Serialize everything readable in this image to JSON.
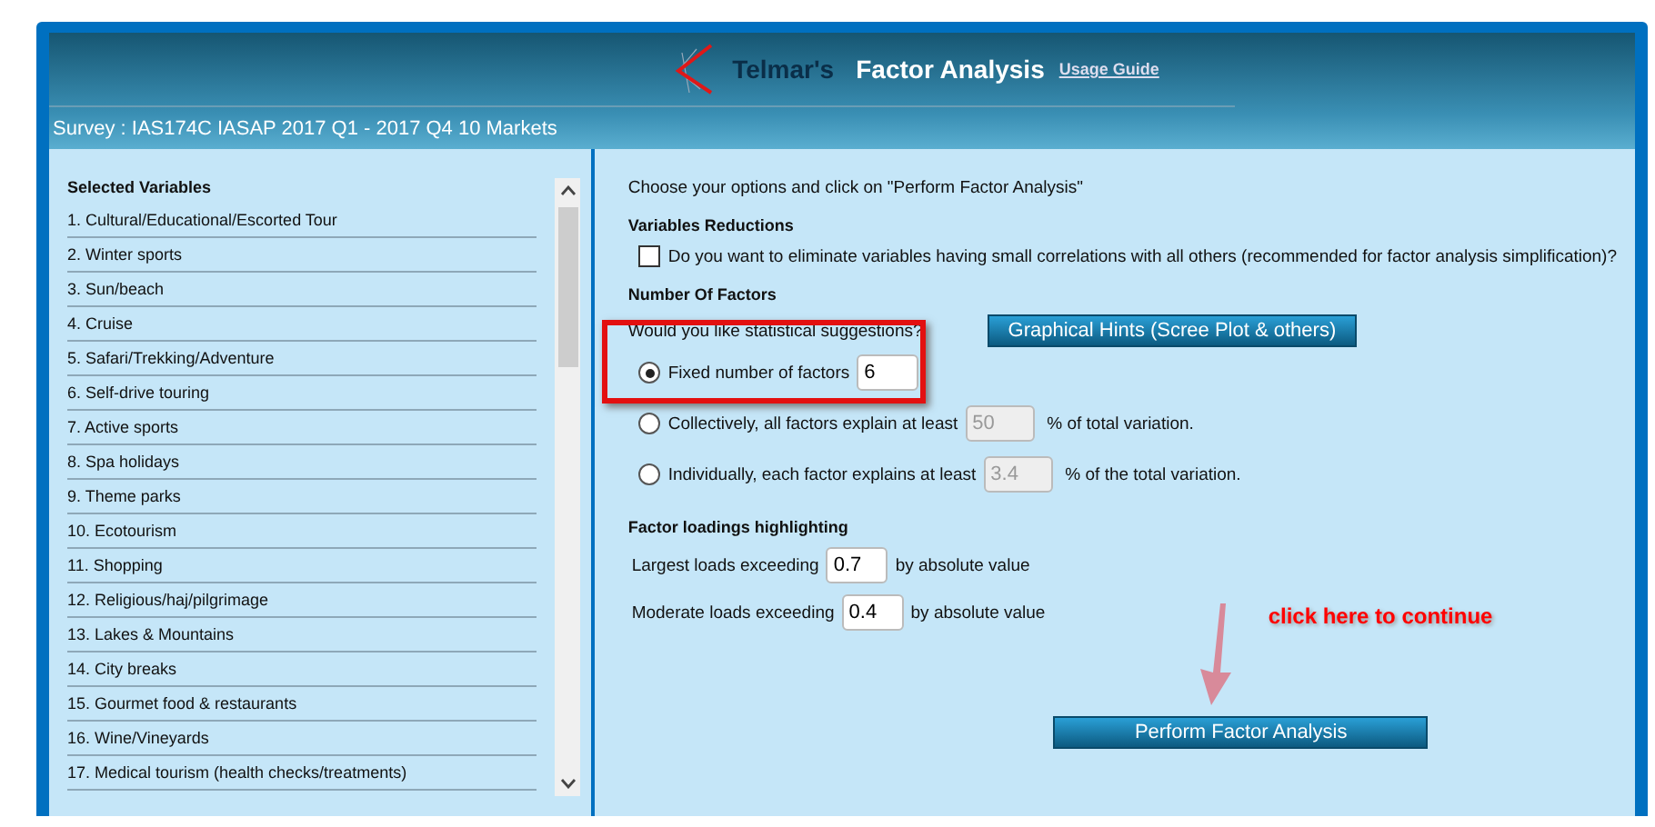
{
  "header": {
    "brand": "Telmar's",
    "title": "Factor Analysis",
    "link": "Usage Guide"
  },
  "survey": "Survey : IAS174C IASAP 2017 Q1 - 2017 Q4 10 Markets",
  "variables": {
    "heading": "Selected Variables",
    "items": [
      "1. Cultural/Educational/Escorted Tour",
      "2. Winter sports",
      "3. Sun/beach",
      "4. Cruise",
      "5. Safari/Trekking/Adventure",
      "6. Self-drive touring",
      "7. Active sports",
      "8. Spa holidays",
      "9. Theme parks",
      "10. Ecotourism",
      "11. Shopping",
      "12. Religious/haj/pilgrimage",
      "13. Lakes & Mountains",
      "14. City breaks",
      "15. Gourmet food & restaurants",
      "16. Wine/Vineyards",
      "17. Medical tourism (health checks/treatments)"
    ]
  },
  "options": {
    "intro": "Choose your options and click on \"Perform Factor Analysis\"",
    "reductions": {
      "heading": "Variables Reductions",
      "label": "Do you want to eliminate variables having small correlations with all others (recommended for factor analysis simplification)?",
      "checked": false
    },
    "factors": {
      "heading": "Number Of Factors",
      "question": "Would you like statistical suggestions?",
      "hints_button": "Graphical Hints (Scree Plot & others)",
      "choices": [
        {
          "label": "Fixed number of factors",
          "value": "6",
          "selected": true,
          "disabled": false
        },
        {
          "label": "Collectively, all factors explain at least",
          "value": "50",
          "suffix": "% of total variation.",
          "selected": false,
          "disabled": true
        },
        {
          "label": "Individually, each factor explains at least",
          "value": "3.4",
          "suffix": "% of the total variation.",
          "selected": false,
          "disabled": true
        }
      ]
    },
    "loadings": {
      "heading": "Factor loadings highlighting",
      "rows": [
        {
          "label": "Largest loads exceeding",
          "value": "0.7",
          "suffix": "by absolute value"
        },
        {
          "label": "Moderate loads exceeding",
          "value": "0.4",
          "suffix": "by absolute value"
        }
      ]
    },
    "annotation": "click here to continue",
    "submit": "Perform Factor Analysis"
  }
}
